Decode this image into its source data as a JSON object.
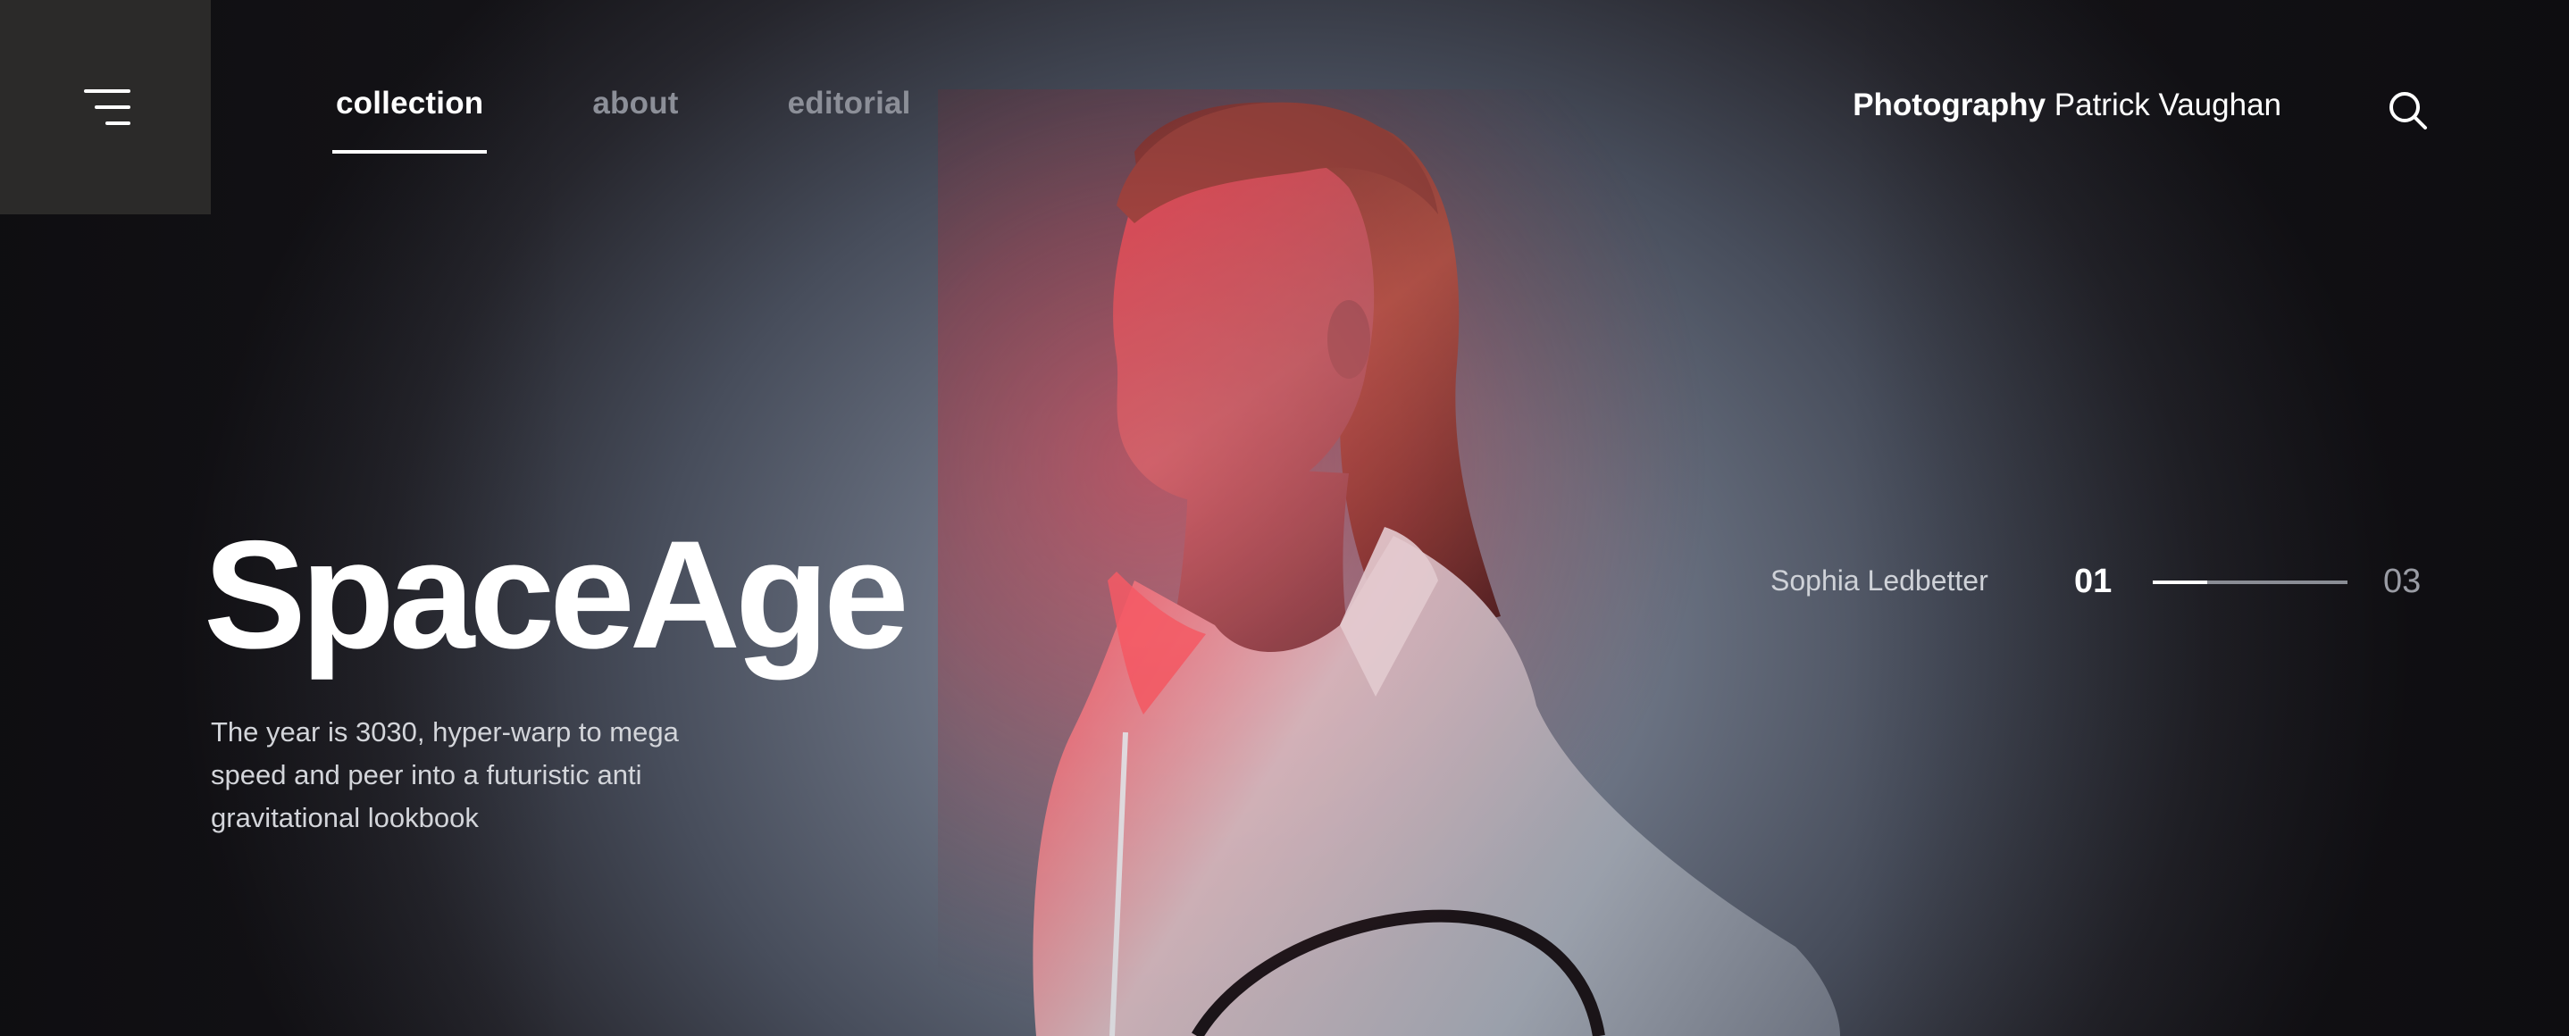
{
  "nav": {
    "items": [
      {
        "label": "collection",
        "active": true
      },
      {
        "label": "about",
        "active": false
      },
      {
        "label": "editorial",
        "active": false
      }
    ]
  },
  "header": {
    "credit_role": "Photography",
    "credit_name": "Patrick Vaughan",
    "menu_icon": "hamburger-menu-icon",
    "search_icon": "search-icon"
  },
  "hero": {
    "title": "SpaceAge",
    "description": "The year is 3030, hyper-warp to mega speed and peer into a futuristic anti gravitational lookbook"
  },
  "slider": {
    "model_name": "Sophia Ledbetter",
    "current": "01",
    "total": "03",
    "progress": 0.28
  },
  "colors": {
    "accent_light": "#ff2a38",
    "menu_box": "#2b2a29",
    "text_primary": "#ffffff",
    "text_muted": "#8c8f98"
  }
}
